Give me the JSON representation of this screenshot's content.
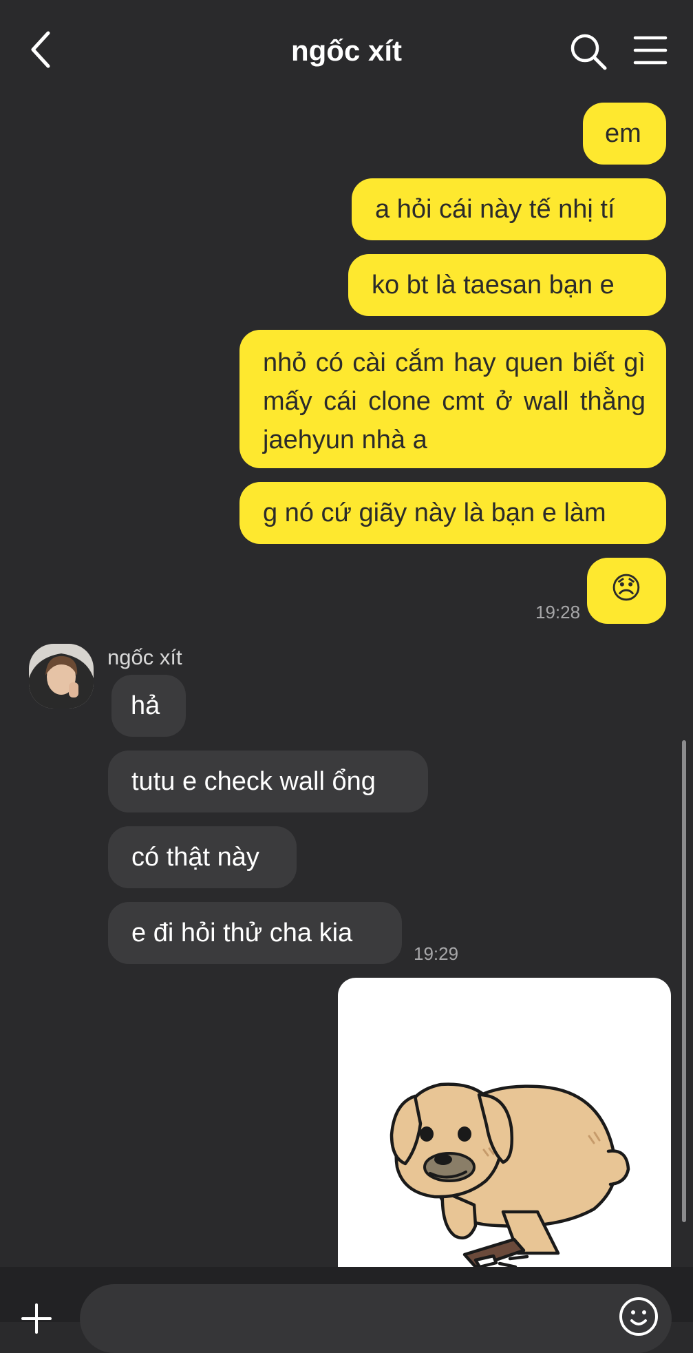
{
  "header": {
    "title": "ngốc xít",
    "back_icon": "chevron-left-icon",
    "search_icon": "search-icon",
    "menu_icon": "hamburger-menu-icon"
  },
  "messages": {
    "m1": "em",
    "m2": "a hỏi cái này tế nhị tí",
    "m3": "ko bt là taesan bạn e",
    "m4": "nhỏ có cài cắm hay quen biết gì mấy cái clone cmt ở wall thằng jaehyun nhà a",
    "m5": "g nó cứ giãy này là bạn e làm",
    "m6_emoji": "😞",
    "time1": "19:28",
    "sender": "ngốc xít",
    "r1": "hả",
    "r2": "tutu e check wall ổng",
    "r3": "có thật này",
    "r4": "e đi hỏi thử cha kia",
    "time2": "19:29"
  },
  "sticker": {
    "icon": "puppy-sticker"
  },
  "composer": {
    "plus_icon": "plus-icon",
    "emoji_icon": "emoji-icon",
    "placeholder": ""
  },
  "colors": {
    "background": "#2a2a2c",
    "outgoing": "#fee82f",
    "incoming": "#3b3b3d"
  }
}
